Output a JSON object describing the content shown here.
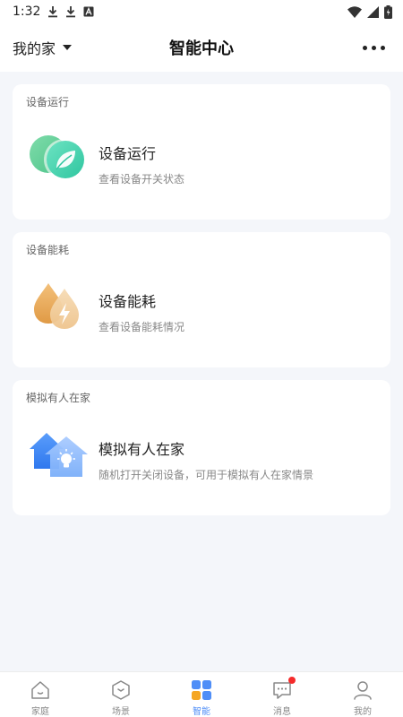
{
  "status_bar": {
    "time": "1:32"
  },
  "header": {
    "home_label": "我的家",
    "title": "智能中心"
  },
  "cards": [
    {
      "section_title": "设备运行",
      "title": "设备运行",
      "desc": "查看设备开关状态",
      "icon": "leaf-icon"
    },
    {
      "section_title": "设备能耗",
      "title": "设备能耗",
      "desc": "查看设备能耗情况",
      "icon": "energy-drop-icon"
    },
    {
      "section_title": "模拟有人在家",
      "title": "模拟有人在家",
      "desc": "随机打开关闭设备，可用于模拟有人在家情景",
      "icon": "house-bulb-icon"
    }
  ],
  "tabs": [
    {
      "label": "家庭",
      "icon": "home-icon"
    },
    {
      "label": "场景",
      "icon": "scene-icon"
    },
    {
      "label": "智能",
      "icon": "smart-grid-icon",
      "active": true
    },
    {
      "label": "消息",
      "icon": "message-icon",
      "badge": true
    },
    {
      "label": "我的",
      "icon": "profile-icon"
    }
  ],
  "colors": {
    "accent": "#4f8ef7",
    "badge": "#f52b2b",
    "background": "#f4f6fa"
  }
}
